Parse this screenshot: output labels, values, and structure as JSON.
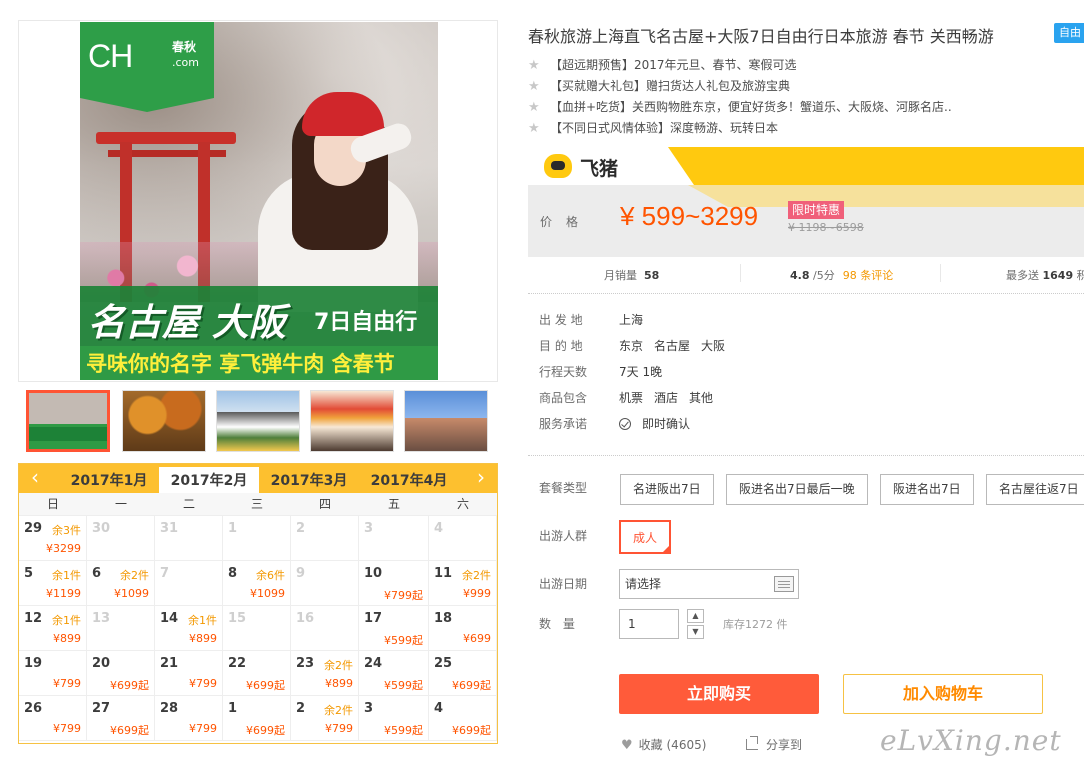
{
  "product": {
    "title": "春秋旅游上海直飞名古屋+大阪7日自由行日本旅游 春节 关西畅游",
    "self_tag": "自由",
    "features": [
      "【超远期预售】2017年元旦、春节、寒假可选",
      "【买就赠大礼包】赠扫货达人礼包及旅游宝典",
      "【血拼+吃货】关西购物胜东京，便宜好货多！蟹道乐、大阪烧、河豚名店..",
      "【不同日式风情体验】深度畅游、玩转日本"
    ]
  },
  "hero": {
    "logo_main": "CH",
    "logo_cn": "春秋",
    "logo_com": ".com",
    "title_main": "名古屋 大阪",
    "title_days": "7日自由行",
    "subtitle": "寻味你的名字 享飞弹牛肉 含春节"
  },
  "promo": {
    "brand": "飞猪",
    "price_label": "价格",
    "price": "¥ 599~3299",
    "limit_tag": "限时特惠",
    "original_price": "¥ 1198~6598"
  },
  "stats": {
    "monthly_label": "月销量",
    "monthly_value": "58",
    "rating_value": "4.8",
    "rating_suffix": "/5分",
    "reviews": "98 条评论",
    "points_label": "最多送",
    "points_value": "1649",
    "points_suffix": "积"
  },
  "info": {
    "rows": [
      {
        "key": "出 发 地",
        "values": [
          "上海"
        ]
      },
      {
        "key": "目 的 地",
        "values": [
          "东京",
          "名古屋",
          "大阪"
        ]
      },
      {
        "key": "行程天数",
        "values": [
          "7天 1晚"
        ]
      },
      {
        "key": "商品包含",
        "values": [
          "机票",
          "酒店",
          "其他"
        ]
      },
      {
        "key": "服务承诺",
        "values": [
          "即时确认"
        ]
      }
    ]
  },
  "options": {
    "package_label": "套餐类型",
    "packages": [
      "名进阪出7日",
      "阪进名出7日最后一晚",
      "阪进名出7日",
      "名古屋往返7日"
    ],
    "crowd_label": "出游人群",
    "crowd_value": "成人",
    "date_label": "出游日期",
    "date_placeholder": "请选择",
    "qty_label": "数  量",
    "qty_value": "1",
    "qty_up": "▲",
    "qty_down": "▼",
    "stock": "库存1272 件"
  },
  "actions": {
    "buy": "立即购买",
    "cart": "加入购物车",
    "favorite": "收藏",
    "favorite_count": "(4605)",
    "share": "分享到"
  },
  "calendar": {
    "prev": "‹",
    "next": "›",
    "months": [
      "2017年1月",
      "2017年2月",
      "2017年3月",
      "2017年4月"
    ],
    "active_month": "2017年2月",
    "weekdays": [
      "日",
      "一",
      "二",
      "三",
      "四",
      "五",
      "六"
    ],
    "weeks": [
      [
        {
          "d": "29",
          "stock": "余3件",
          "price": "¥3299"
        },
        {
          "d": "30",
          "off": true
        },
        {
          "d": "31",
          "off": true
        },
        {
          "d": "1",
          "off": true
        },
        {
          "d": "2",
          "off": true
        },
        {
          "d": "3",
          "off": true
        },
        {
          "d": "4",
          "off": true
        }
      ],
      [
        {
          "d": "5",
          "stock": "余1件",
          "price": "¥1199"
        },
        {
          "d": "6",
          "stock": "余2件",
          "price": "¥1099"
        },
        {
          "d": "7",
          "off": true
        },
        {
          "d": "8",
          "stock": "余6件",
          "price": "¥1099"
        },
        {
          "d": "9",
          "off": true
        },
        {
          "d": "10",
          "price": "¥799起"
        },
        {
          "d": "11",
          "stock": "余2件",
          "price": "¥999"
        }
      ],
      [
        {
          "d": "12",
          "stock": "余1件",
          "price": "¥899"
        },
        {
          "d": "13",
          "off": true
        },
        {
          "d": "14",
          "stock": "余1件",
          "price": "¥899"
        },
        {
          "d": "15",
          "off": true
        },
        {
          "d": "16",
          "off": true
        },
        {
          "d": "17",
          "price": "¥599起"
        },
        {
          "d": "18",
          "price": "¥699"
        }
      ],
      [
        {
          "d": "19",
          "price": "¥799"
        },
        {
          "d": "20",
          "price": "¥699起"
        },
        {
          "d": "21",
          "price": "¥799"
        },
        {
          "d": "22",
          "price": "¥699起"
        },
        {
          "d": "23",
          "stock": "余2件",
          "price": "¥899"
        },
        {
          "d": "24",
          "price": "¥599起"
        },
        {
          "d": "25",
          "price": "¥699起"
        }
      ],
      [
        {
          "d": "26",
          "price": "¥799"
        },
        {
          "d": "27",
          "price": "¥699起"
        },
        {
          "d": "28",
          "price": "¥799"
        },
        {
          "d": "1",
          "price": "¥699起"
        },
        {
          "d": "2",
          "stock": "余2件",
          "price": "¥799"
        },
        {
          "d": "3",
          "price": "¥599起"
        },
        {
          "d": "4",
          "price": "¥699起"
        }
      ]
    ]
  },
  "watermark": "eLvXing.net",
  "colors": {
    "accent_orange": "#ff5400",
    "brand_yellow": "#ffc90f",
    "buy_red": "#ff5b3a",
    "logo_green": "#2e9e48"
  }
}
